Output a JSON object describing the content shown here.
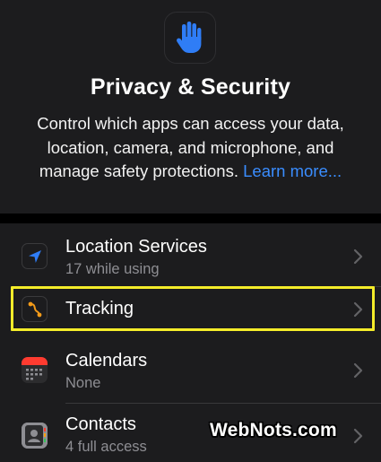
{
  "header": {
    "app_icon": "raised-hand-icon",
    "title": "Privacy & Security",
    "description": "Control which apps can access your data, location, camera, and microphone, and manage safety protections.",
    "learn_more": "Learn more..."
  },
  "list": {
    "items": [
      {
        "label": "Location Services",
        "subtitle": "17 while using",
        "icon": "location-arrow-icon",
        "icon_color": "#1c1c1e"
      },
      {
        "label": "Tracking",
        "subtitle": "",
        "icon": "tracking-icon",
        "icon_color": "#f29a19"
      },
      {
        "label": "Calendars",
        "subtitle": "None",
        "icon": "calendar-icon",
        "icon_color": "#ff3b30"
      },
      {
        "label": "Contacts",
        "subtitle": "4 full access",
        "icon": "contacts-icon",
        "icon_color": "#8e8e93"
      }
    ]
  },
  "highlight_color": "#f4ec2a",
  "accent_color": "#3a8dff",
  "watermark": "WebNots.com"
}
